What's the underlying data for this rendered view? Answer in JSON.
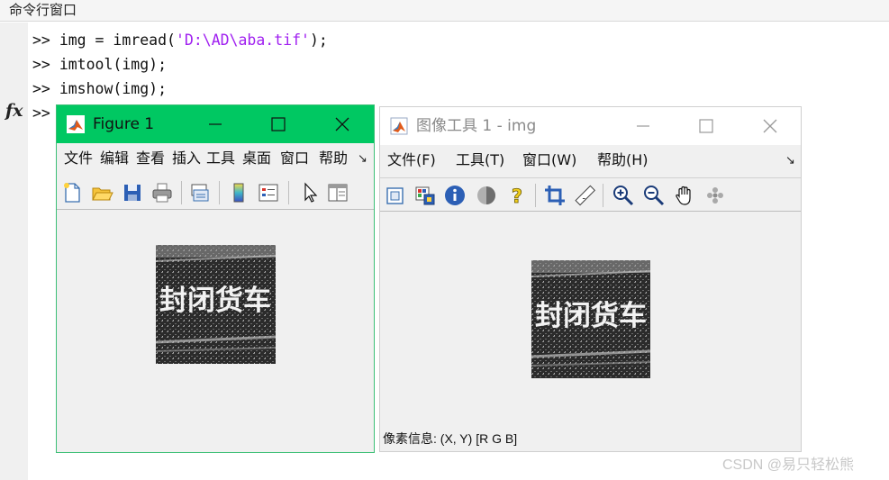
{
  "command_window": {
    "title": "命令行窗口",
    "lines": [
      {
        "prompt": ">> ",
        "pre": "img = imread(",
        "string": "'D:\\AD\\aba.tif'",
        "post": ");"
      },
      {
        "prompt": ">> ",
        "pre": "imtool(img);",
        "string": "",
        "post": ""
      },
      {
        "prompt": ">> ",
        "pre": "imshow(img);",
        "string": "",
        "post": ""
      },
      {
        "prompt": ">> ",
        "pre": "",
        "string": "",
        "post": ""
      }
    ],
    "fx_label": "fx"
  },
  "figure1": {
    "title": "Figure 1",
    "menu": [
      "文件",
      "编辑",
      "查看",
      "插入",
      "工具",
      "桌面",
      "窗口",
      "帮助"
    ],
    "image_text": "封闭货车"
  },
  "imtool": {
    "title": "图像工具 1 - img",
    "menu": [
      "文件(F)",
      "工具(T)",
      "窗口(W)",
      "帮助(H)"
    ],
    "image_text": "封闭货车",
    "pixel_info": "像素信息: (X, Y)  [R G B]"
  },
  "colors": {
    "figure_titlebar": "#00c862",
    "string_literal": "#a020f0",
    "window_bg": "#f0f0f0"
  },
  "watermark": "CSDN @易只轻松熊"
}
